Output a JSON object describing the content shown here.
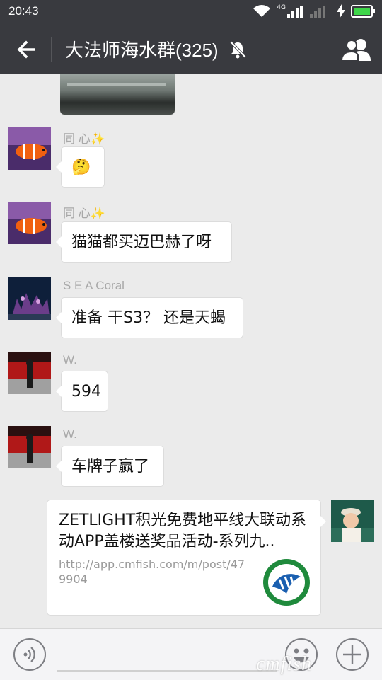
{
  "status": {
    "time": "20:43",
    "network": "4G"
  },
  "header": {
    "title": "大法师海水群(325)"
  },
  "messages": [
    {
      "sender": "同 心✨",
      "text": "🤔"
    },
    {
      "sender": "同 心✨",
      "text": "猫猫都买迈巴赫了呀"
    },
    {
      "sender": "S E A Coral",
      "text": "准备 干S3？  还是天蝎"
    },
    {
      "sender": "W.",
      "text": "594"
    },
    {
      "sender": "W.",
      "text": "车牌子赢了"
    }
  ],
  "link_card": {
    "title": "ZETLIGHT积光免费地平线大联动系动APP盖楼送奖品活动-系列九..",
    "url": "http://app.cmfish.com/m/post/479904"
  },
  "watermark": "cmfish"
}
